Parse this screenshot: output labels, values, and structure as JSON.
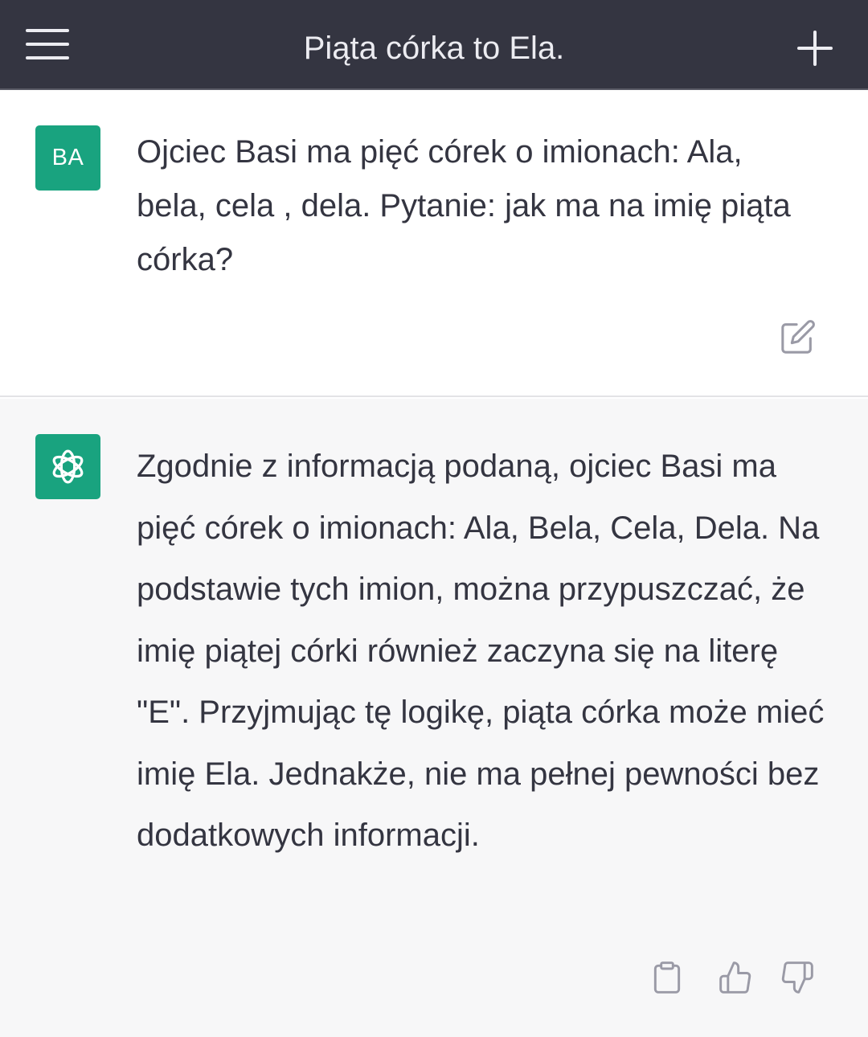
{
  "header": {
    "title": "Piąta córka to Ela.",
    "menu_icon": "hamburger-menu-icon",
    "new_chat_icon": "plus-icon"
  },
  "user_message": {
    "avatar_initials": "BA",
    "text": "Ojciec Basi ma pięć córek o imionach: Ala, bela, cela , dela. Pytanie: jak ma na imię piąta córka?",
    "edit_icon": "edit-icon"
  },
  "assistant_message": {
    "avatar_icon": "openai-logo-icon",
    "text": "Zgodnie z informacją podaną, ojciec Basi ma pięć córek o imionach: Ala, Bela, Cela, Dela. Na podstawie tych imion, można przypuszczać, że imię piątej córki również zaczyna się na literę \"E\". Przyjmując tę logikę, piąta córka może mieć imię Ela. Jednakże, nie ma pełnej pewności bez dodatkowych informacji.",
    "copy_icon": "clipboard-icon",
    "thumbs_up_icon": "thumbs-up-icon",
    "thumbs_down_icon": "thumbs-down-icon"
  },
  "colors": {
    "header_bg": "#343541",
    "avatar_green": "#19a37f",
    "assistant_bg": "#f7f7f8",
    "text": "#343541",
    "icon_gray": "#9a9aa6"
  }
}
